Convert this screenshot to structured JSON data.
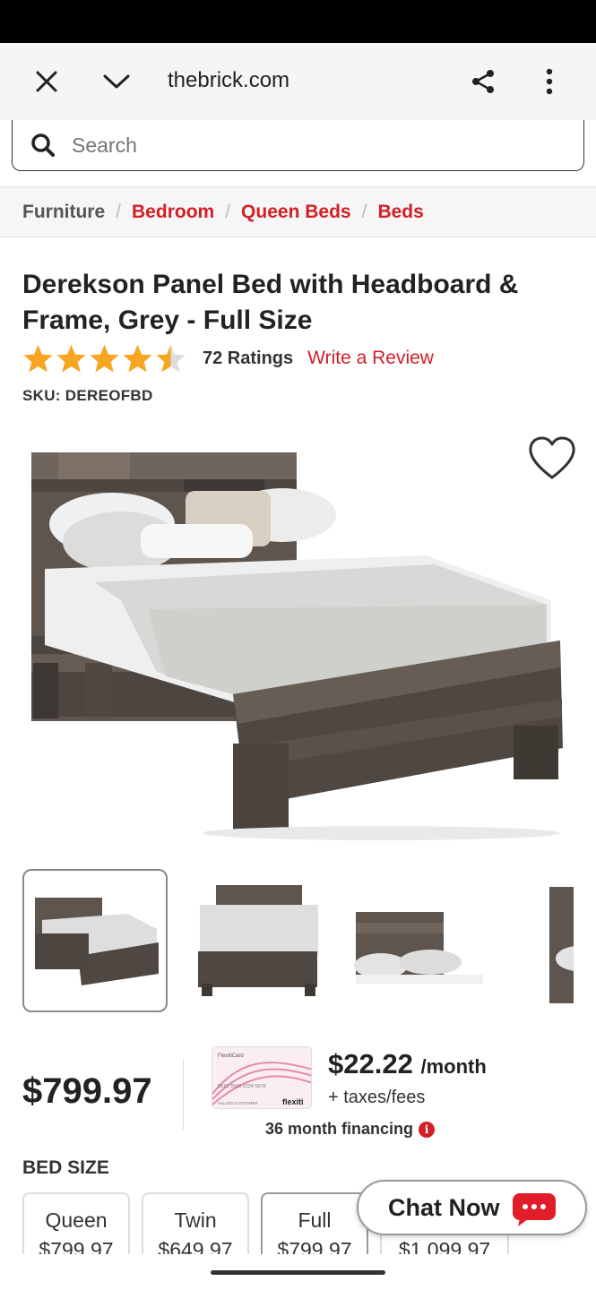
{
  "browser": {
    "url": "thebrick.com"
  },
  "search": {
    "placeholder": "Search"
  },
  "breadcrumb": [
    "Furniture",
    "Bedroom",
    "Queen Beds",
    "Beds"
  ],
  "product": {
    "title": "Derekson Panel Bed with Headboard & Frame, Grey - Full Size",
    "rating": 4.5,
    "ratings_count": "72 Ratings",
    "write_review": "Write a Review",
    "sku": "SKU: DEREOFBD",
    "price": "$799.97",
    "monthly_amount": "$22.22",
    "monthly_unit": "/month",
    "taxes": "+ taxes/fees",
    "financing": "36 month financing"
  },
  "card": {
    "brand": "FlexitiCard",
    "number": "5015 3545 1234 5678",
    "holder": "VALUED CUSTOMER",
    "logo": "flexiti"
  },
  "bed_size": {
    "label": "BED SIZE",
    "options": [
      {
        "name": "Queen",
        "price": "$799.97"
      },
      {
        "name": "Twin",
        "price": "$649.97"
      },
      {
        "name": "Full",
        "price": "$799.97",
        "selected": true
      },
      {
        "name": "",
        "price": "$1,099.97"
      }
    ]
  },
  "chat": {
    "label": "Chat Now"
  },
  "colors": {
    "accent": "#d31e25",
    "star": "#f6a623",
    "text": "#222222"
  }
}
